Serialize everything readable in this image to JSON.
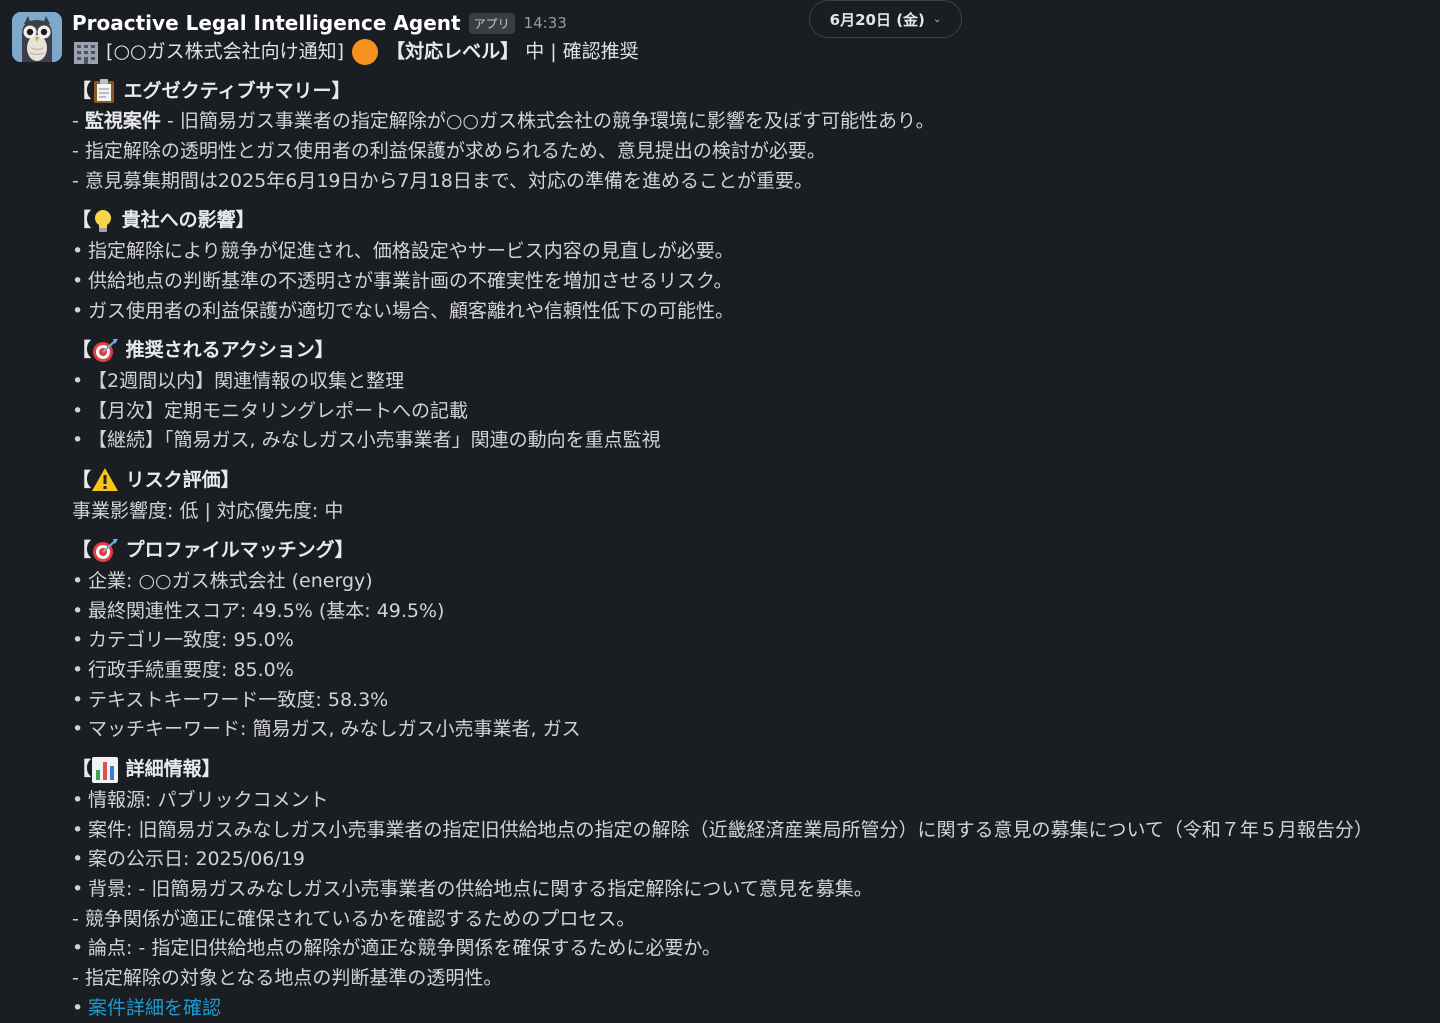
{
  "message": {
    "sender": "Proactive Legal Intelligence Agent",
    "app_badge": "アプリ",
    "time": "14:33",
    "date_divider": "6月20日 (金)",
    "title": {
      "prefix": "[○○ガス株式会社向け通知]",
      "level_label": "【対応レベル】",
      "level_value": "中 | 確認推奨"
    },
    "summary": {
      "heading": "エグゼクティブサマリー】",
      "lines": [
        {
          "bold": "監視案件",
          "text": " - 旧簡易ガス事業者の指定解除が○○ガス株式会社の競争環境に影響を及ぼす可能性あり。"
        },
        {
          "text": "- 指定解除の透明性とガス使用者の利益保護が求められるため、意見提出の検討が必要。"
        },
        {
          "text": "- 意見募集期間は2025年6月19日から7月18日まで、対応の準備を進めることが重要。"
        }
      ]
    },
    "impact": {
      "heading": "貴社への影響】",
      "items": [
        "指定解除により競争が促進され、価格設定やサービス内容の見直しが必要。",
        "供給地点の判断基準の不透明さが事業計画の不確実性を増加させるリスク。",
        "ガス使用者の利益保護が適切でない場合、顧客離れや信頼性低下の可能性。"
      ]
    },
    "actions": {
      "heading": "推奨されるアクション】",
      "items": [
        "【2週間以内】関連情報の収集と整理",
        "【月次】定期モニタリングレポートへの記載",
        "【継続】「簡易ガス, みなしガス小売事業者」関連の動向を重点監視"
      ]
    },
    "risk": {
      "heading": "リスク評価】",
      "text": "事業影響度: 低 | 対応優先度: 中"
    },
    "profile": {
      "heading": "プロファイルマッチング】",
      "items": [
        "企業: ○○ガス株式会社 (energy)",
        "最終関連性スコア: 49.5% (基本: 49.5%)",
        "カテゴリ一致度: 95.0%",
        "行政手続重要度: 85.0%",
        "テキストキーワード一致度: 58.3%",
        "マッチキーワード: 簡易ガス, みなしガス小売事業者, ガス"
      ]
    },
    "details": {
      "heading": "詳細情報】",
      "source": "情報源: パブリックコメント",
      "case": "案件: 旧簡易ガスみなしガス小売事業者の指定旧供給地点の指定の解除（近畿経済産業局所管分）に関する意見の募集について（令和７年５月報告分）",
      "published": "案の公示日: 2025/06/19",
      "background": "背景: - 旧簡易ガスみなしガス小売事業者の供給地点に関する指定解除について意見を募集。",
      "background_cont": "- 競争関係が適正に確保されているかを確認するためのプロセス。",
      "issue": "論点: - 指定旧供給地点の解除が適正な競争関係を確保するために必要か。",
      "issue_cont": "- 指定解除の対象となる地点の判断基準の透明性。",
      "link_text": "案件詳細を確認"
    }
  },
  "colors": {
    "background": "#1a1d21",
    "text": "#d1d2d3",
    "link": "#1d9bd1",
    "badge": "#3a3d42"
  },
  "icons": [
    "owl-avatar",
    "office-building-icon",
    "orange-circle-icon",
    "clipboard-icon",
    "lightbulb-icon",
    "dart-target-icon",
    "warning-icon",
    "bar-chart-icon",
    "chevron-down-icon"
  ]
}
